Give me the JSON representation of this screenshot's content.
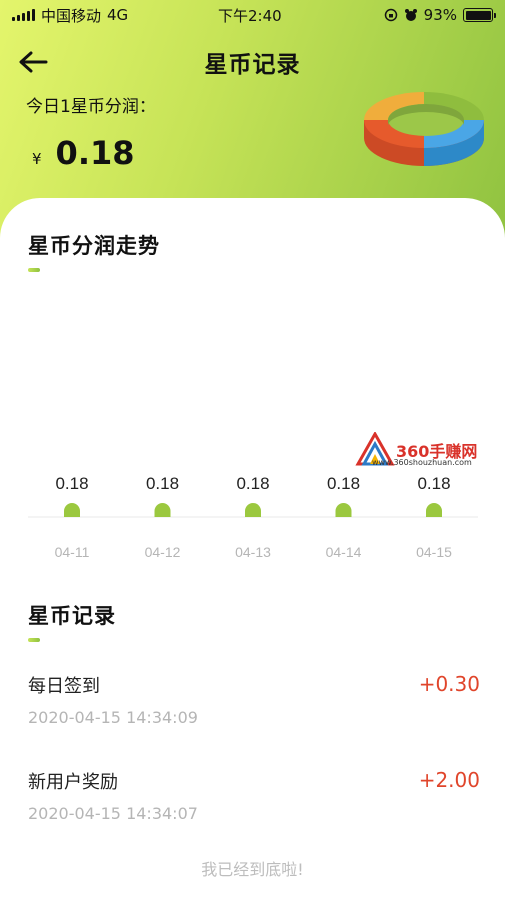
{
  "status_bar": {
    "carrier": "中国移动",
    "network": "4G",
    "time": "下午2:40",
    "battery": "93%"
  },
  "nav": {
    "title": "星币记录",
    "back_icon": "arrow-left-icon"
  },
  "summary": {
    "today_label": "今日1星币分润：",
    "currency": "¥",
    "amount": "0.18"
  },
  "trend": {
    "title": "星币分润走势"
  },
  "chart_data": {
    "type": "bar",
    "categories": [
      "04-11",
      "04-12",
      "04-13",
      "04-14",
      "04-15"
    ],
    "values": [
      0.18,
      0.18,
      0.18,
      0.18,
      0.18
    ],
    "data_labels": [
      "0.18",
      "0.18",
      "0.18",
      "0.18",
      "0.18"
    ],
    "title": "星币分润走势",
    "bar_color": "#9bc83f",
    "axis_color": "#f0f0f0"
  },
  "watermark": {
    "text": "360手赚网",
    "sub": "www.360shouzhuan.com"
  },
  "records": {
    "title": "星币记录",
    "items": [
      {
        "name": "每日签到",
        "amount": "+0.30",
        "time": "2020-04-15 14:34:09"
      },
      {
        "name": "新用户奖励",
        "amount": "+2.00",
        "time": "2020-04-15 14:34:07"
      }
    ],
    "end_text": "我已经到底啦!"
  },
  "colors": {
    "accent_red": "#e0452b",
    "gradient_start": "#e4f56c",
    "gradient_end": "#8fc240"
  }
}
